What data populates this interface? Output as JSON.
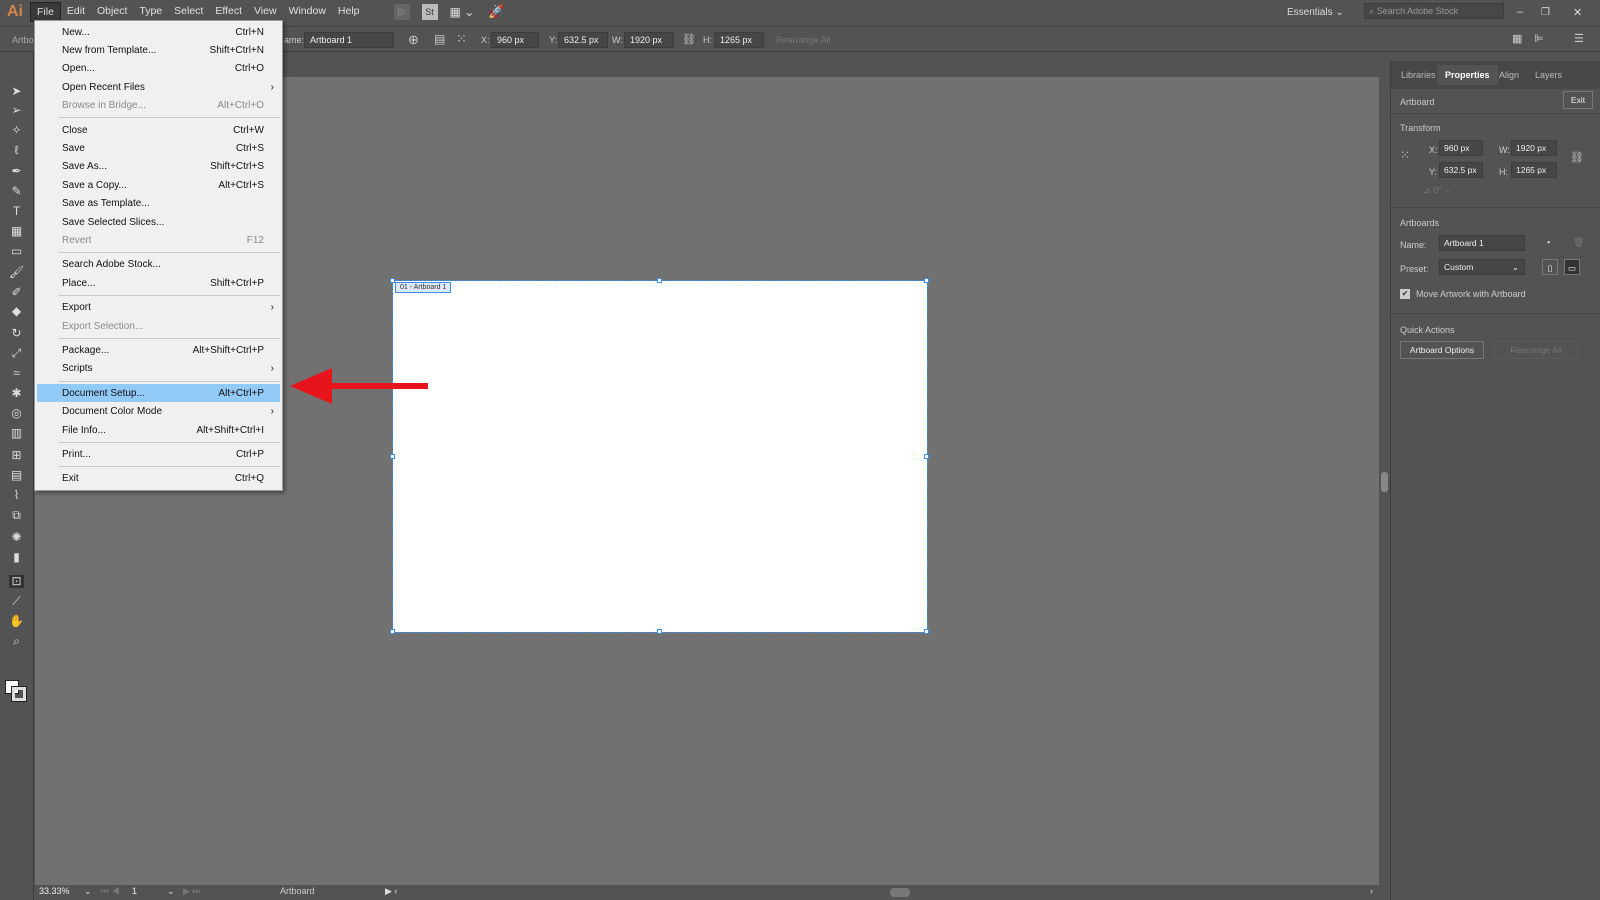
{
  "app": {
    "logo": "Ai",
    "accent": "#d4884a"
  },
  "menubar": {
    "items": [
      "File",
      "Edit",
      "Object",
      "Type",
      "Select",
      "Effect",
      "View",
      "Window",
      "Help"
    ],
    "icons": [
      "Br",
      "St"
    ],
    "workspace": "Essentials",
    "search_placeholder": "Search Adobe Stock"
  },
  "control": {
    "left_label": "Artbo",
    "name_label": "ame:",
    "name_value": "Artboard 1",
    "x_label": "X:",
    "x": "960 px",
    "y_label": "Y:",
    "y": "632.5 px",
    "w_label": "W:",
    "w": "1920 px",
    "h_label": "H:",
    "h": "1265 px",
    "rearrange": "Rearrange All"
  },
  "file_menu": [
    {
      "label": "New...",
      "shortcut": "Ctrl+N"
    },
    {
      "label": "New from Template...",
      "shortcut": "Shift+Ctrl+N"
    },
    {
      "label": "Open...",
      "shortcut": "Ctrl+O"
    },
    {
      "label": "Open Recent Files",
      "shortcut": "",
      "submenu": true
    },
    {
      "label": "Browse in Bridge...",
      "shortcut": "Alt+Ctrl+O",
      "disabled": true
    },
    {
      "sep": true
    },
    {
      "label": "Close",
      "shortcut": "Ctrl+W"
    },
    {
      "label": "Save",
      "shortcut": "Ctrl+S"
    },
    {
      "label": "Save As...",
      "shortcut": "Shift+Ctrl+S"
    },
    {
      "label": "Save a Copy...",
      "shortcut": "Alt+Ctrl+S"
    },
    {
      "label": "Save as Template...",
      "shortcut": ""
    },
    {
      "label": "Save Selected Slices...",
      "shortcut": ""
    },
    {
      "label": "Revert",
      "shortcut": "F12",
      "disabled": true
    },
    {
      "sep": true
    },
    {
      "label": "Search Adobe Stock...",
      "shortcut": ""
    },
    {
      "label": "Place...",
      "shortcut": "Shift+Ctrl+P"
    },
    {
      "sep": true
    },
    {
      "label": "Export",
      "shortcut": "",
      "submenu": true
    },
    {
      "label": "Export Selection...",
      "shortcut": "",
      "disabled": true
    },
    {
      "sep": true
    },
    {
      "label": "Package...",
      "shortcut": "Alt+Shift+Ctrl+P"
    },
    {
      "label": "Scripts",
      "shortcut": "",
      "submenu": true
    },
    {
      "sep": true
    },
    {
      "label": "Document Setup...",
      "shortcut": "Alt+Ctrl+P",
      "highlighted": true
    },
    {
      "label": "Document Color Mode",
      "shortcut": "",
      "submenu": true
    },
    {
      "label": "File Info...",
      "shortcut": "Alt+Shift+Ctrl+I"
    },
    {
      "sep": true
    },
    {
      "label": "Print...",
      "shortcut": "Ctrl+P"
    },
    {
      "sep": true
    },
    {
      "label": "Exit",
      "shortcut": "Ctrl+Q"
    }
  ],
  "canvas": {
    "artboard_label": "01 - Artboard 1",
    "annotation_arrow_color": "#e8141b"
  },
  "panel": {
    "tabs": [
      "Libraries",
      "Properties",
      "Align",
      "Layers"
    ],
    "active_tab": "Properties",
    "section": "Artboard",
    "exit": "Exit",
    "transform": {
      "title": "Transform",
      "x_label": "X:",
      "x": "960 px",
      "y_label": "Y:",
      "y": "632.5 px",
      "w_label": "W:",
      "w": "1920 px",
      "h_label": "H:",
      "h": "1265 px",
      "angle": "0°"
    },
    "artboards": {
      "title": "Artboards",
      "name_label": "Name:",
      "name": "Artboard 1",
      "preset_label": "Preset:",
      "preset": "Custom",
      "move_artwork": "Move Artwork with Artboard",
      "move_checked": true
    },
    "quick": {
      "title": "Quick Actions",
      "options": "Artboard Options",
      "rearrange": "Rearrange All"
    }
  },
  "status": {
    "zoom": "33.33%",
    "page": "1",
    "mode": "Artboard"
  }
}
